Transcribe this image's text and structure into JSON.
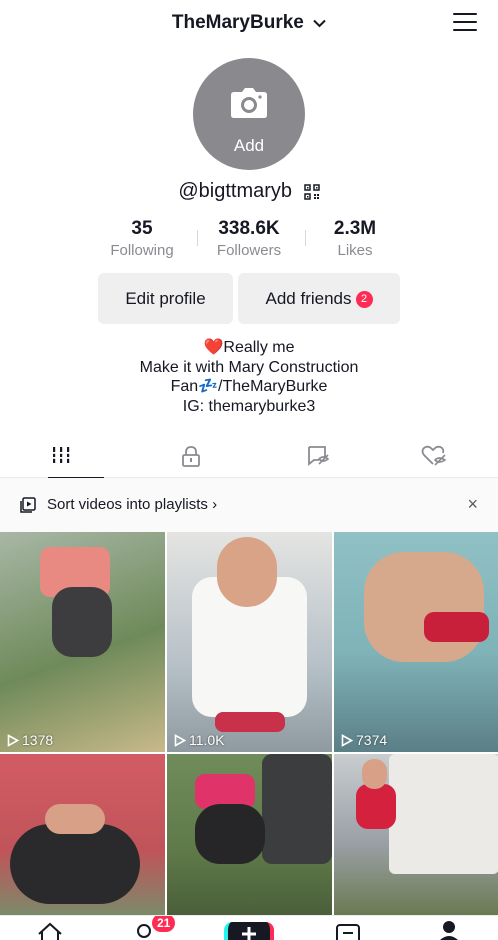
{
  "header": {
    "account_name": "TheMaryBurke",
    "menu_icon": "hamburger-menu-icon"
  },
  "profile": {
    "avatar_label": "Add",
    "avatar_icon": "camera-icon",
    "handle": "@bigttmaryb",
    "qr_icon": "qr-code-icon",
    "stats": [
      {
        "value": "35",
        "label": "Following"
      },
      {
        "value": "338.6K",
        "label": "Followers"
      },
      {
        "value": "2.3M",
        "label": "Likes"
      }
    ],
    "edit_profile_label": "Edit profile",
    "add_friends_label": "Add friends",
    "add_friends_badge": "2",
    "bio_lines": [
      "❤️Really me",
      "Make it with Mary Construction",
      "Fan💤/TheMaryBurke",
      "IG: themaryburke3"
    ]
  },
  "tabs": [
    {
      "icon": "videos-grid-icon",
      "active": true
    },
    {
      "icon": "private-lock-icon",
      "active": false
    },
    {
      "icon": "reposts-icon",
      "active": false
    },
    {
      "icon": "liked-hidden-icon",
      "active": false
    }
  ],
  "playlist_prompt": {
    "text": "Sort videos into playlists ›",
    "close": "×"
  },
  "videos": [
    {
      "views": "1378",
      "color": "#6f8a5a"
    },
    {
      "views": "11.0K",
      "color": "#cfd3d6"
    },
    {
      "views": "7374",
      "color": "#7fb3b8"
    },
    {
      "views": "",
      "color": "#c0545a"
    },
    {
      "views": "",
      "color": "#5f7a48"
    },
    {
      "views": "",
      "color": "#9aa0a6"
    }
  ],
  "bottom_nav": {
    "inbox_badge": "21"
  },
  "colors": {
    "accent": "#fe2c55",
    "text_primary": "#161823",
    "text_secondary": "#8a8b91",
    "button_bg": "#efeff0"
  }
}
